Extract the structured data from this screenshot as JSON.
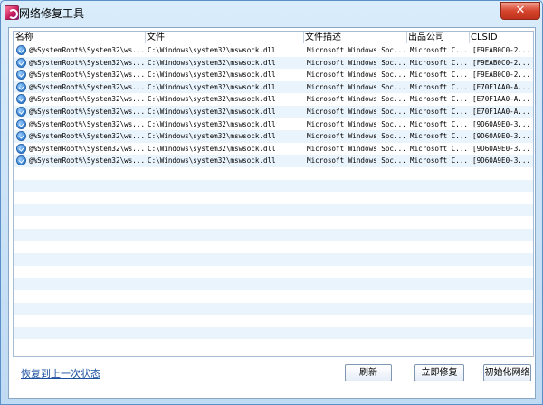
{
  "window": {
    "title": "网络修复工具",
    "close_label": "✕"
  },
  "table": {
    "columns": [
      "名称",
      "文件",
      "文件描述",
      "出品公司",
      "CLSID"
    ],
    "rows": [
      [
        "@%SystemRoot%\\System32\\ws...",
        "C:\\Windows\\system32\\mswsock.dll",
        "Microsoft Windows Soc...",
        "Microsoft C...",
        "[F9EAB0C0-2..."
      ],
      [
        "@%SystemRoot%\\System32\\ws...",
        "C:\\Windows\\system32\\mswsock.dll",
        "Microsoft Windows Soc...",
        "Microsoft C...",
        "[F9EAB0C0-2..."
      ],
      [
        "@%SystemRoot%\\System32\\ws...",
        "C:\\Windows\\system32\\mswsock.dll",
        "Microsoft Windows Soc...",
        "Microsoft C...",
        "[F9EAB0C0-2..."
      ],
      [
        "@%SystemRoot%\\System32\\ws...",
        "C:\\Windows\\system32\\mswsock.dll",
        "Microsoft Windows Soc...",
        "Microsoft C...",
        "[E70F1AA0-A..."
      ],
      [
        "@%SystemRoot%\\System32\\ws...",
        "C:\\Windows\\system32\\mswsock.dll",
        "Microsoft Windows Soc...",
        "Microsoft C...",
        "[E70F1AA0-A..."
      ],
      [
        "@%SystemRoot%\\System32\\ws...",
        "C:\\Windows\\system32\\mswsock.dll",
        "Microsoft Windows Soc...",
        "Microsoft C...",
        "[E70F1AA0-A..."
      ],
      [
        "@%SystemRoot%\\System32\\ws...",
        "C:\\Windows\\system32\\mswsock.dll",
        "Microsoft Windows Soc...",
        "Microsoft C...",
        "[9D60A9E0-3..."
      ],
      [
        "@%SystemRoot%\\System32\\ws...",
        "C:\\Windows\\system32\\mswsock.dll",
        "Microsoft Windows Soc...",
        "Microsoft C...",
        "[9D60A9E0-3..."
      ],
      [
        "@%SystemRoot%\\System32\\ws...",
        "C:\\Windows\\system32\\mswsock.dll",
        "Microsoft Windows Soc...",
        "Microsoft C...",
        "[9D60A9E0-3..."
      ],
      [
        "@%SystemRoot%\\System32\\ws...",
        "C:\\Windows\\system32\\mswsock.dll",
        "Microsoft Windows Soc...",
        "Microsoft C...",
        "[9D60A9E0-3..."
      ]
    ]
  },
  "footer": {
    "restore_link": "恢复到上一次状态",
    "refresh_button": "刷新",
    "repair_button": "立即修复",
    "init_button": "初始化网络"
  }
}
